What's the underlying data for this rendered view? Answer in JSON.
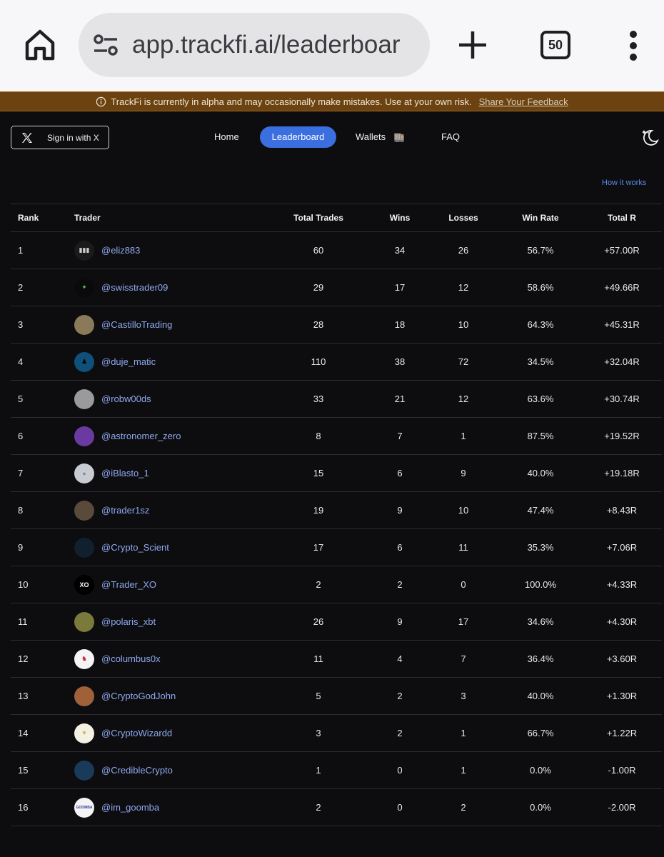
{
  "browser": {
    "url": "app.trackfi.ai/leaderboar",
    "tab_count": "50"
  },
  "banner": {
    "message": "TrackFi is currently in alpha and may occasionally make mistakes. Use at your own risk.",
    "feedback_link": "Share Your Feedback"
  },
  "nav": {
    "signin_label": "Sign in with X",
    "home": "Home",
    "leaderboard": "Leaderboard",
    "wallets": "Wallets",
    "wallets_emoji": "🏬",
    "faq": "FAQ",
    "how_it_works": "How it works"
  },
  "colors": {
    "accent": "#3b6fe0",
    "banner_bg": "#6b4210",
    "handle": "#8fa8ee",
    "background": "#0d0d0f"
  },
  "table": {
    "headers": {
      "rank": "Rank",
      "trader": "Trader",
      "total_trades": "Total Trades",
      "wins": "Wins",
      "losses": "Losses",
      "win_rate": "Win Rate",
      "total_r": "Total R"
    },
    "rows": [
      {
        "rank": "1",
        "trader": "@eliz883",
        "trades": "60",
        "wins": "34",
        "losses": "26",
        "rate": "56.7%",
        "total": "+57.00R",
        "av_bg": "#1a1a1a",
        "av_fg": "#cccccc",
        "av_text": "▮▮▮"
      },
      {
        "rank": "2",
        "trader": "@swisstrader09",
        "trades": "29",
        "wins": "17",
        "losses": "12",
        "rate": "58.6%",
        "total": "+49.66R",
        "av_bg": "#0a0a0a",
        "av_fg": "#4ec25a",
        "av_text": "✦"
      },
      {
        "rank": "3",
        "trader": "@CastilloTrading",
        "trades": "28",
        "wins": "18",
        "losses": "10",
        "rate": "64.3%",
        "total": "+45.31R",
        "av_bg": "#8a7a5a",
        "av_fg": "#2a3a5a",
        "av_text": ""
      },
      {
        "rank": "4",
        "trader": "@duje_matic",
        "trades": "110",
        "wins": "38",
        "losses": "72",
        "rate": "34.5%",
        "total": "+32.04R",
        "av_bg": "#0f4f7a",
        "av_fg": "#000000",
        "av_text": "♟"
      },
      {
        "rank": "5",
        "trader": "@robw00ds",
        "trades": "33",
        "wins": "21",
        "losses": "12",
        "rate": "63.6%",
        "total": "+30.74R",
        "av_bg": "#9a9a9a",
        "av_fg": "#222222",
        "av_text": ""
      },
      {
        "rank": "6",
        "trader": "@astronomer_zero",
        "trades": "8",
        "wins": "7",
        "losses": "1",
        "rate": "87.5%",
        "total": "+19.52R",
        "av_bg": "#6a3aa0",
        "av_fg": "#f0a050",
        "av_text": ""
      },
      {
        "rank": "7",
        "trader": "@iBlasto_1",
        "trades": "15",
        "wins": "6",
        "losses": "9",
        "rate": "40.0%",
        "total": "+19.18R",
        "av_bg": "#c8ccd2",
        "av_fg": "#8a9098",
        "av_text": "●"
      },
      {
        "rank": "8",
        "trader": "@trader1sz",
        "trades": "19",
        "wins": "9",
        "losses": "10",
        "rate": "47.4%",
        "total": "+8.43R",
        "av_bg": "#5a4a3a",
        "av_fg": "#222222",
        "av_text": ""
      },
      {
        "rank": "9",
        "trader": "@Crypto_Scient",
        "trades": "17",
        "wins": "6",
        "losses": "11",
        "rate": "35.3%",
        "total": "+7.06R",
        "av_bg": "#10202e",
        "av_fg": "#3a7ab0",
        "av_text": ""
      },
      {
        "rank": "10",
        "trader": "@Trader_XO",
        "trades": "2",
        "wins": "2",
        "losses": "0",
        "rate": "100.0%",
        "total": "+4.33R",
        "av_bg": "#000000",
        "av_fg": "#ffffff",
        "av_text": "XO"
      },
      {
        "rank": "11",
        "trader": "@polaris_xbt",
        "trades": "26",
        "wins": "9",
        "losses": "17",
        "rate": "34.6%",
        "total": "+4.30R",
        "av_bg": "#7a7a3a",
        "av_fg": "#d0c080",
        "av_text": ""
      },
      {
        "rank": "12",
        "trader": "@columbus0x",
        "trades": "11",
        "wins": "4",
        "losses": "7",
        "rate": "36.4%",
        "total": "+3.60R",
        "av_bg": "#f4f4f4",
        "av_fg": "#c02030",
        "av_text": "♞"
      },
      {
        "rank": "13",
        "trader": "@CryptoGodJohn",
        "trades": "5",
        "wins": "2",
        "losses": "3",
        "rate": "40.0%",
        "total": "+1.30R",
        "av_bg": "#a0603a",
        "av_fg": "#e0c080",
        "av_text": ""
      },
      {
        "rank": "14",
        "trader": "@CryptoWizardd",
        "trades": "3",
        "wins": "2",
        "losses": "1",
        "rate": "66.7%",
        "total": "+1.22R",
        "av_bg": "#f4f0e4",
        "av_fg": "#c0a030",
        "av_text": "✶"
      },
      {
        "rank": "15",
        "trader": "@CredibleCrypto",
        "trades": "1",
        "wins": "0",
        "losses": "1",
        "rate": "0.0%",
        "total": "-1.00R",
        "av_bg": "#1a3a5a",
        "av_fg": "#d0a030",
        "av_text": ""
      },
      {
        "rank": "16",
        "trader": "@im_goomba",
        "trades": "2",
        "wins": "0",
        "losses": "2",
        "rate": "0.0%",
        "total": "-2.00R",
        "av_bg": "#f4f4f4",
        "av_fg": "#3040a0",
        "av_text": "GOOMBA"
      }
    ]
  }
}
